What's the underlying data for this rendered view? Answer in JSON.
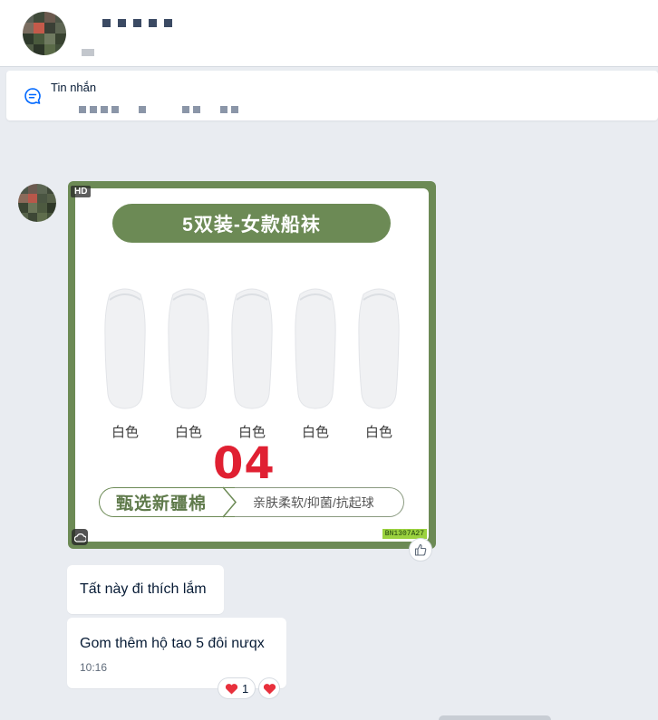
{
  "colors": {
    "accent": "#0068ff",
    "card_green": "#6c8a55",
    "number_red": "#e02032",
    "heart_red": "#e8303c",
    "tag_green": "#9bd23f"
  },
  "header": {
    "avatar_icon": "avatar-blurred"
  },
  "pinned": {
    "icon": "chat-bubble-icon",
    "title": "Tin nhắn"
  },
  "product_image": {
    "hd_badge": "HD",
    "title": "5双装-女款船袜",
    "sock_count": 5,
    "sock_label": "白色",
    "big_number": "04",
    "ribbon_left": "甄选新疆棉",
    "ribbon_right": "亲肤柔软/抑菌/抗起球",
    "code_tag": "BN1307A27"
  },
  "messages": [
    {
      "text": "Tất này đi thích lắm"
    },
    {
      "text": "Gom thêm hộ tao 5 đôi nưqx",
      "time": "10:16"
    }
  ],
  "reactions": {
    "count": "1",
    "icon": "heart-icon"
  }
}
